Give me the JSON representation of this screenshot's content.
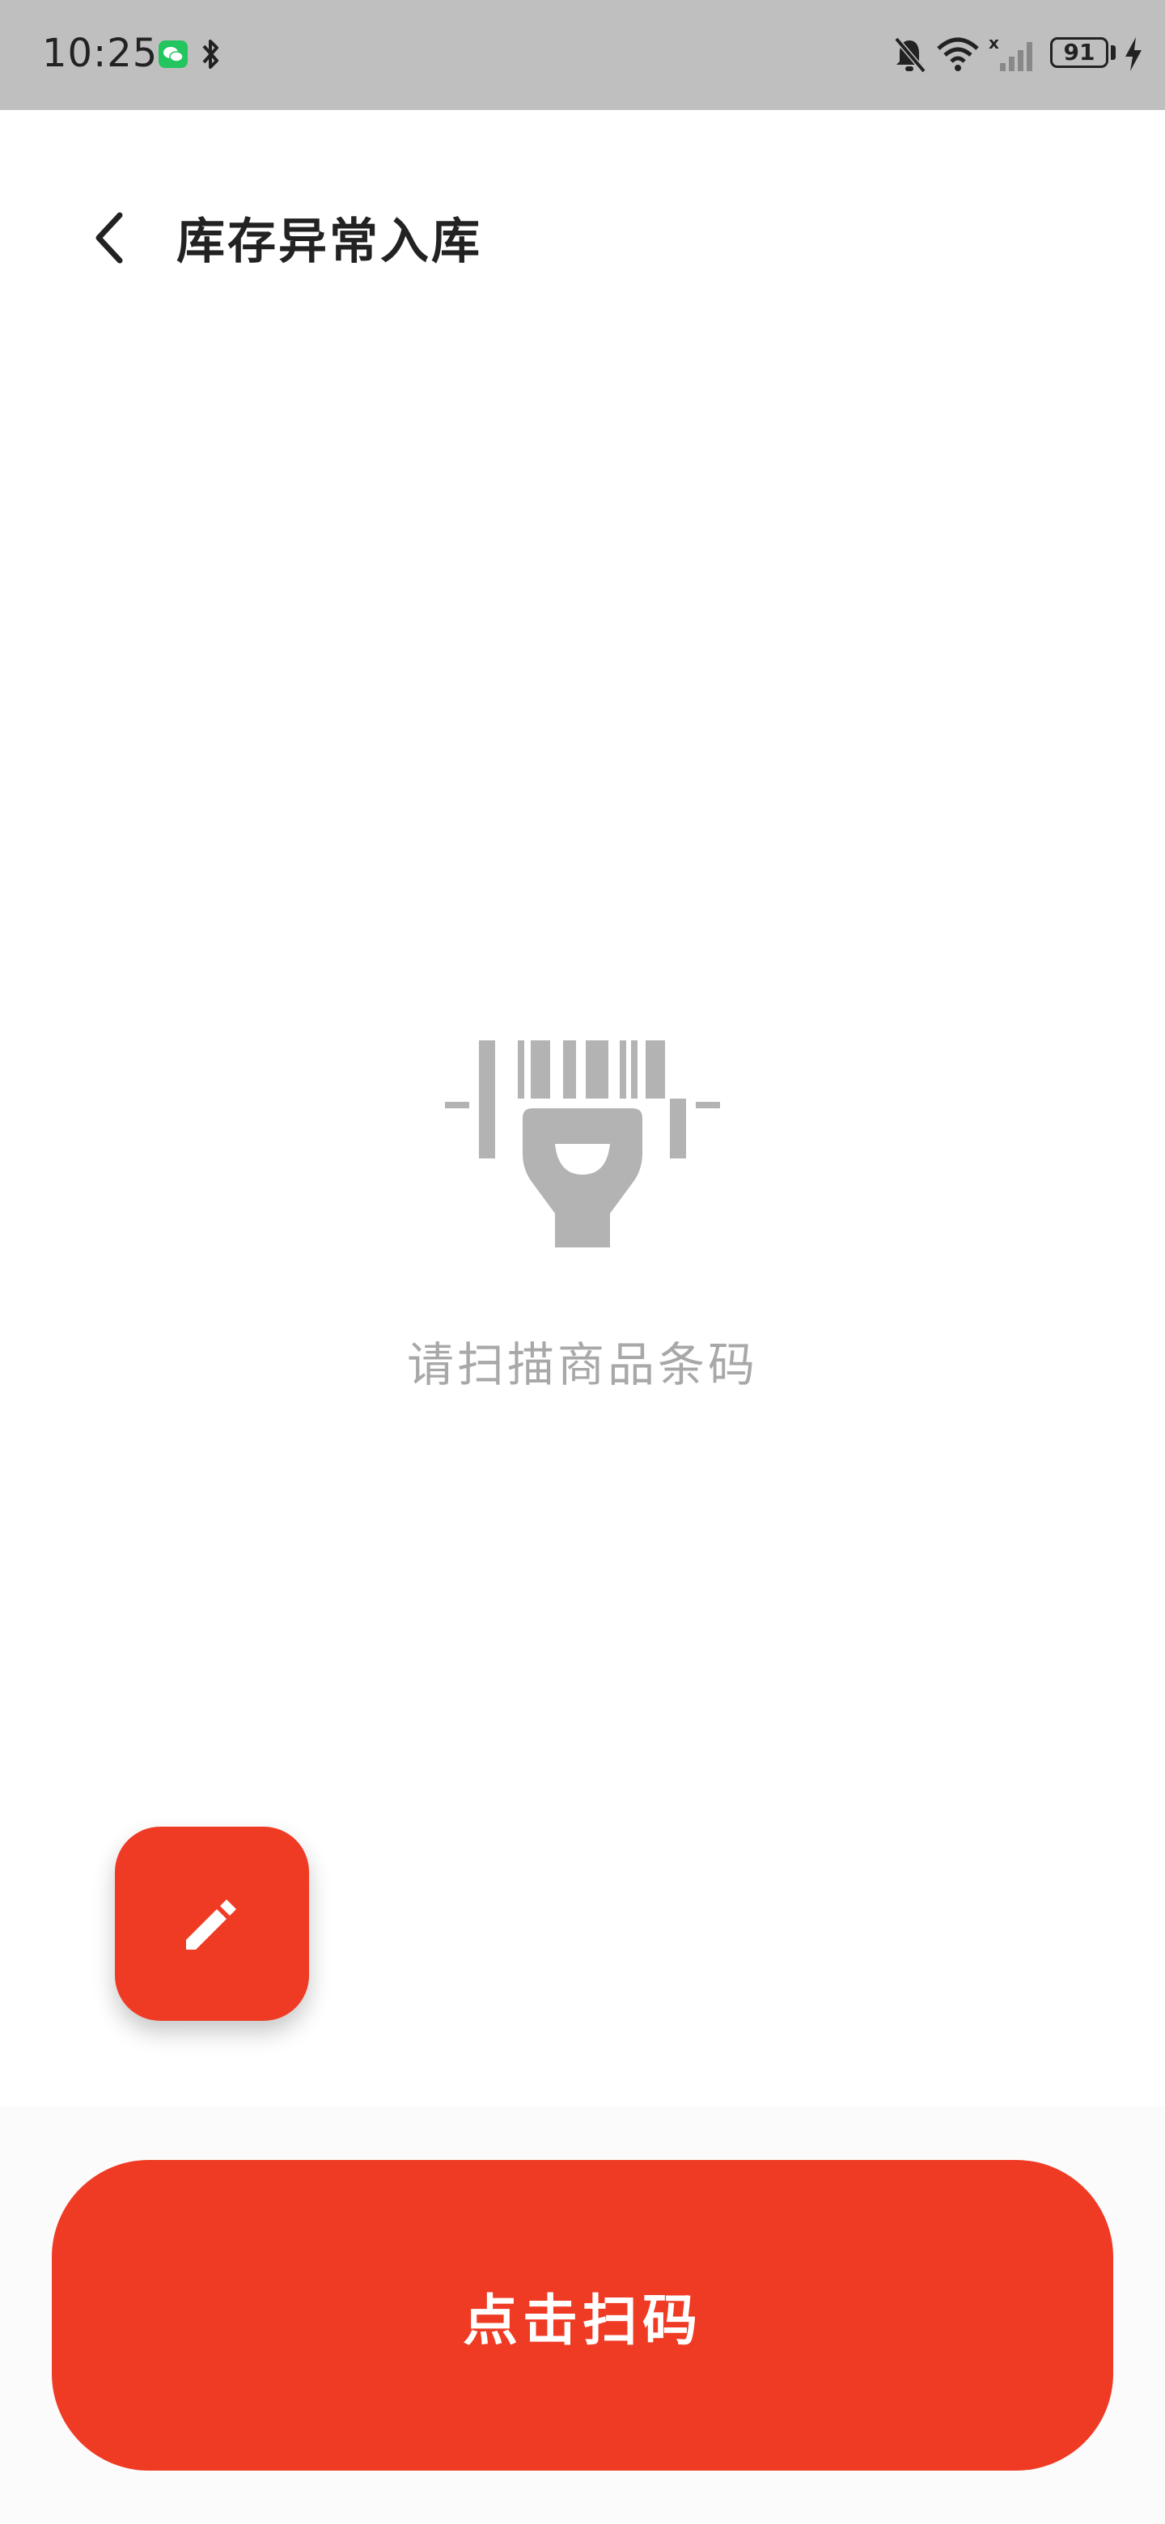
{
  "status_bar": {
    "time": "10:25",
    "battery_level": "91",
    "icons": [
      "wechat-icon",
      "bluetooth-icon",
      "mute-bell-icon",
      "wifi-icon",
      "no-signal-icon",
      "battery-icon",
      "charging-icon"
    ]
  },
  "header": {
    "title": "库存异常入库",
    "back_icon": "chevron-left-icon"
  },
  "empty_state": {
    "icon": "barcode-scanner-icon",
    "hint": "请扫描商品条码"
  },
  "fab": {
    "icon": "pencil-icon"
  },
  "footer": {
    "scan_button_label": "点击扫码"
  },
  "colors": {
    "accent": "#ef3b24",
    "status_bar_bg": "#bfbfbf",
    "hint_text": "#a8a8a8",
    "title_text": "#222222"
  }
}
